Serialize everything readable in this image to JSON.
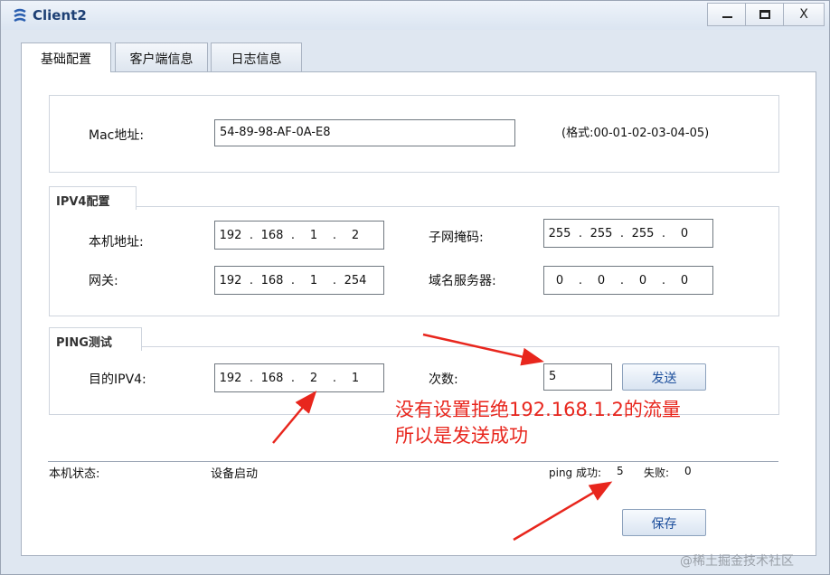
{
  "window": {
    "title": "Client2",
    "close_glyph": "X"
  },
  "tabs": [
    {
      "label": "基础配置",
      "active": true
    },
    {
      "label": "客户端信息",
      "active": false
    },
    {
      "label": "日志信息",
      "active": false
    }
  ],
  "mac": {
    "label": "Mac地址:",
    "value": "54-89-98-AF-0A-E8",
    "hint": "(格式:00-01-02-03-04-05)"
  },
  "ipv4": {
    "title": "IPV4配置",
    "local_label": "本机地址:",
    "local": [
      "192",
      "168",
      "1",
      "2"
    ],
    "mask_label": "子网掩码:",
    "mask": [
      "255",
      "255",
      "255",
      "0"
    ],
    "gateway_label": "网关:",
    "gateway": [
      "192",
      "168",
      "1",
      "254"
    ],
    "dns_label": "域名服务器:",
    "dns": [
      "0",
      "0",
      "0",
      "0"
    ]
  },
  "ping": {
    "title": "PING测试",
    "target_label": "目的IPV4:",
    "target": [
      "192",
      "168",
      "2",
      "1"
    ],
    "count_label": "次数:",
    "count": "5",
    "send_label": "发送"
  },
  "status": {
    "label": "本机状态:",
    "value": "设备启动",
    "success_label": "ping 成功:",
    "success": "5",
    "fail_label": "失败:",
    "fail": "0"
  },
  "save_label": "保存",
  "annotation": {
    "line1": "没有设置拒绝192.168.1.2的流量",
    "line2": "所以是发送成功",
    "color": "#e8261d"
  },
  "watermark": "@稀土掘金技术社区"
}
